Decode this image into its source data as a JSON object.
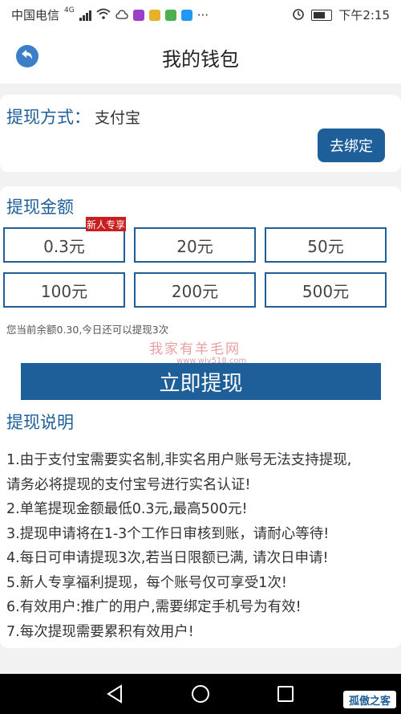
{
  "status_bar": {
    "carrier": "中国电信",
    "network": "4G",
    "time": "下午2:15",
    "more": "···"
  },
  "nav": {
    "title": "我的钱包"
  },
  "withdraw_method": {
    "label": "提现方式：",
    "value": "支付宝",
    "bind_button": "去绑定"
  },
  "amount_section": {
    "title": "提现金额",
    "new_user_badge": "新人专享",
    "options": [
      "0.3元",
      "20元",
      "50元",
      "100元",
      "200元",
      "500元"
    ],
    "balance_note": "您当前余额0.30,今日还可以提现3次"
  },
  "watermark": {
    "line1": "我家有羊毛网",
    "line2": "www.wjy518.com"
  },
  "withdraw_button": "立即提现",
  "rules": {
    "title": "提现说明",
    "items": [
      "1.由于支付宝需要实名制,非实名用户账号无法支持提现,",
      "请务必将提现的支付宝号进行实名认证!",
      "2.单笔提现金额最低0.3元,最高500元!",
      "3.提现申请将在1-3个工作日审核到账，请耐心等待!",
      "4.每日可申请提现3次,若当日限额已满, 请次日申请!",
      "5.新人专享福利提现，每个账号仅可享受1次!",
      "6.有效用户:推广的用户,需要绑定手机号为有效!",
      "7.每次提现需要累积有效用户!"
    ]
  },
  "corner_logo": "孤傲之客",
  "colors": {
    "primary": "#1e5f99",
    "badge": "#c81e1e",
    "back_button": "#3a7fc7"
  }
}
